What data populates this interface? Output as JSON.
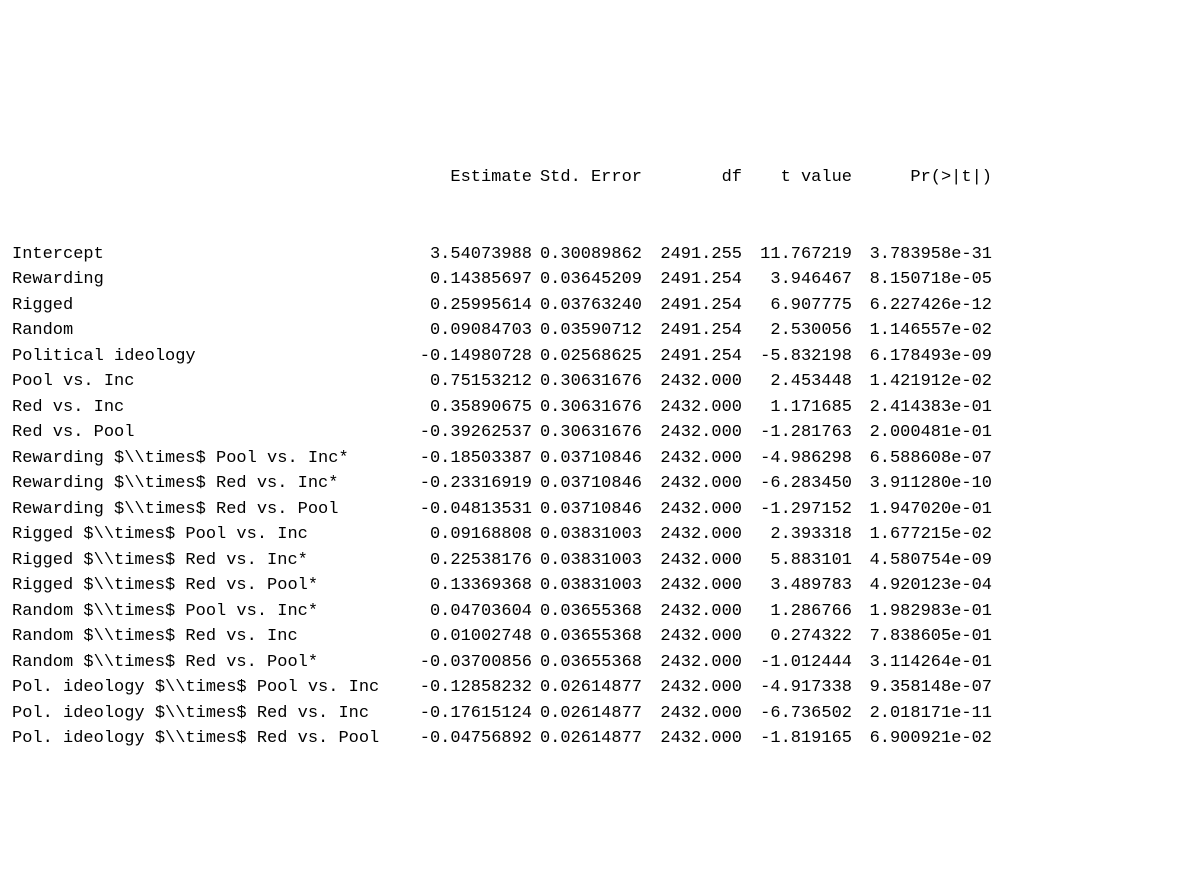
{
  "headers": {
    "estimate": "Estimate",
    "se": "Std. Error",
    "df": "df",
    "t": "t value",
    "p": "Pr(>|t|)"
  },
  "rows": [
    {
      "label": "Intercept",
      "est": "3.54073988",
      "se": "0.30089862",
      "df": "2491.255",
      "t": "11.767219",
      "p": "3.783958e-31"
    },
    {
      "label": "Rewarding",
      "est": "0.14385697",
      "se": "0.03645209",
      "df": "2491.254",
      "t": "3.946467",
      "p": "8.150718e-05"
    },
    {
      "label": "Rigged",
      "est": "0.25995614",
      "se": "0.03763240",
      "df": "2491.254",
      "t": "6.907775",
      "p": "6.227426e-12"
    },
    {
      "label": "Random",
      "est": "0.09084703",
      "se": "0.03590712",
      "df": "2491.254",
      "t": "2.530056",
      "p": "1.146557e-02"
    },
    {
      "label": "Political ideology",
      "est": "-0.14980728",
      "se": "0.02568625",
      "df": "2491.254",
      "t": "-5.832198",
      "p": "6.178493e-09"
    },
    {
      "label": "Pool vs. Inc",
      "est": "0.75153212",
      "se": "0.30631676",
      "df": "2432.000",
      "t": "2.453448",
      "p": "1.421912e-02"
    },
    {
      "label": "Red vs. Inc",
      "est": "0.35890675",
      "se": "0.30631676",
      "df": "2432.000",
      "t": "1.171685",
      "p": "2.414383e-01"
    },
    {
      "label": "Red vs. Pool",
      "est": "-0.39262537",
      "se": "0.30631676",
      "df": "2432.000",
      "t": "-1.281763",
      "p": "2.000481e-01"
    },
    {
      "label": "Rewarding $\\\\times$ Pool vs. Inc*",
      "est": "-0.18503387",
      "se": "0.03710846",
      "df": "2432.000",
      "t": "-4.986298",
      "p": "6.588608e-07"
    },
    {
      "label": "Rewarding $\\\\times$ Red vs. Inc*",
      "est": "-0.23316919",
      "se": "0.03710846",
      "df": "2432.000",
      "t": "-6.283450",
      "p": "3.911280e-10"
    },
    {
      "label": "Rewarding $\\\\times$ Red vs. Pool",
      "est": "-0.04813531",
      "se": "0.03710846",
      "df": "2432.000",
      "t": "-1.297152",
      "p": "1.947020e-01"
    },
    {
      "label": "Rigged $\\\\times$ Pool vs. Inc",
      "est": "0.09168808",
      "se": "0.03831003",
      "df": "2432.000",
      "t": "2.393318",
      "p": "1.677215e-02"
    },
    {
      "label": "Rigged $\\\\times$ Red vs. Inc*",
      "est": "0.22538176",
      "se": "0.03831003",
      "df": "2432.000",
      "t": "5.883101",
      "p": "4.580754e-09"
    },
    {
      "label": "Rigged $\\\\times$ Red vs. Pool*",
      "est": "0.13369368",
      "se": "0.03831003",
      "df": "2432.000",
      "t": "3.489783",
      "p": "4.920123e-04"
    },
    {
      "label": "Random $\\\\times$ Pool vs. Inc*",
      "est": "0.04703604",
      "se": "0.03655368",
      "df": "2432.000",
      "t": "1.286766",
      "p": "1.982983e-01"
    },
    {
      "label": "Random $\\\\times$ Red vs. Inc",
      "est": "0.01002748",
      "se": "0.03655368",
      "df": "2432.000",
      "t": "0.274322",
      "p": "7.838605e-01"
    },
    {
      "label": "Random $\\\\times$ Red vs. Pool*",
      "est": "-0.03700856",
      "se": "0.03655368",
      "df": "2432.000",
      "t": "-1.012444",
      "p": "3.114264e-01"
    },
    {
      "label": "Pol. ideology $\\\\times$ Pool vs. Inc",
      "est": "-0.12858232",
      "se": "0.02614877",
      "df": "2432.000",
      "t": "-4.917338",
      "p": "9.358148e-07"
    },
    {
      "label": "Pol. ideology $\\\\times$ Red vs. Inc",
      "est": "-0.17615124",
      "se": "0.02614877",
      "df": "2432.000",
      "t": "-6.736502",
      "p": "2.018171e-11"
    },
    {
      "label": "Pol. ideology $\\\\times$ Red vs. Pool",
      "est": "-0.04756892",
      "se": "0.02614877",
      "df": "2432.000",
      "t": "-1.819165",
      "p": "6.900921e-02"
    }
  ]
}
